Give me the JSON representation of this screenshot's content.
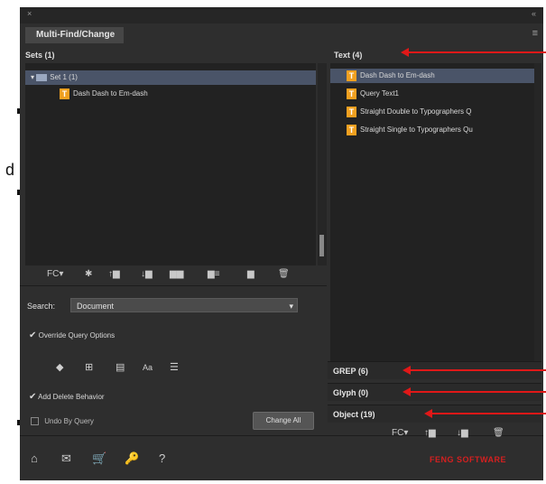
{
  "window": {
    "close_glyph": "×",
    "collapse_glyph": "«",
    "title": "Multi-Find/Change",
    "menu_glyph": "≡"
  },
  "sets": {
    "header": "Sets (1)",
    "tree": [
      {
        "label": "Set 1 (1)",
        "kind": "folder",
        "selected": true
      },
      {
        "label": "Dash Dash to Em-dash",
        "kind": "query",
        "selected": false
      }
    ],
    "toolbar": [
      "FC▾",
      "✱",
      "↑▆",
      "↓▆",
      "▆▆",
      "▆≡",
      "▆",
      "🗑"
    ]
  },
  "search": {
    "label": "Search:",
    "value": "Document",
    "override_label": "Override Query Options",
    "override_checked": true,
    "option_icons": [
      "◆",
      "⊞",
      "▤",
      "Aa",
      "☰"
    ],
    "add_delete_label": "Add Delete Behavior",
    "add_delete_checked": true,
    "undo_label": "Undo By Query",
    "undo_checked": false,
    "change_all_label": "Change All"
  },
  "bottom_icons": [
    "⌂",
    "✉",
    "🛒",
    "🔑",
    "?"
  ],
  "brand_label": "FENG SOFTWARE",
  "text_list": {
    "header": "Text (4)",
    "items": [
      {
        "label": "Dash Dash to Em-dash",
        "selected": true
      },
      {
        "label": "Query Text1",
        "selected": false
      },
      {
        "label": "Straight Double to Typographers Q",
        "selected": false
      },
      {
        "label": "Straight Single to Typographers Qu",
        "selected": false
      }
    ]
  },
  "sections": {
    "grep": "GREP (6)",
    "glyph": "Glyph (0)",
    "object": "Object (19)"
  },
  "right_toolbar": [
    "FC▾",
    "↑▆",
    "↓▆",
    "🗑"
  ],
  "side_letter": "d",
  "colors": {
    "arrow": "#e01818",
    "icon_orange": "#f0a020",
    "selection": "#4a5468"
  }
}
